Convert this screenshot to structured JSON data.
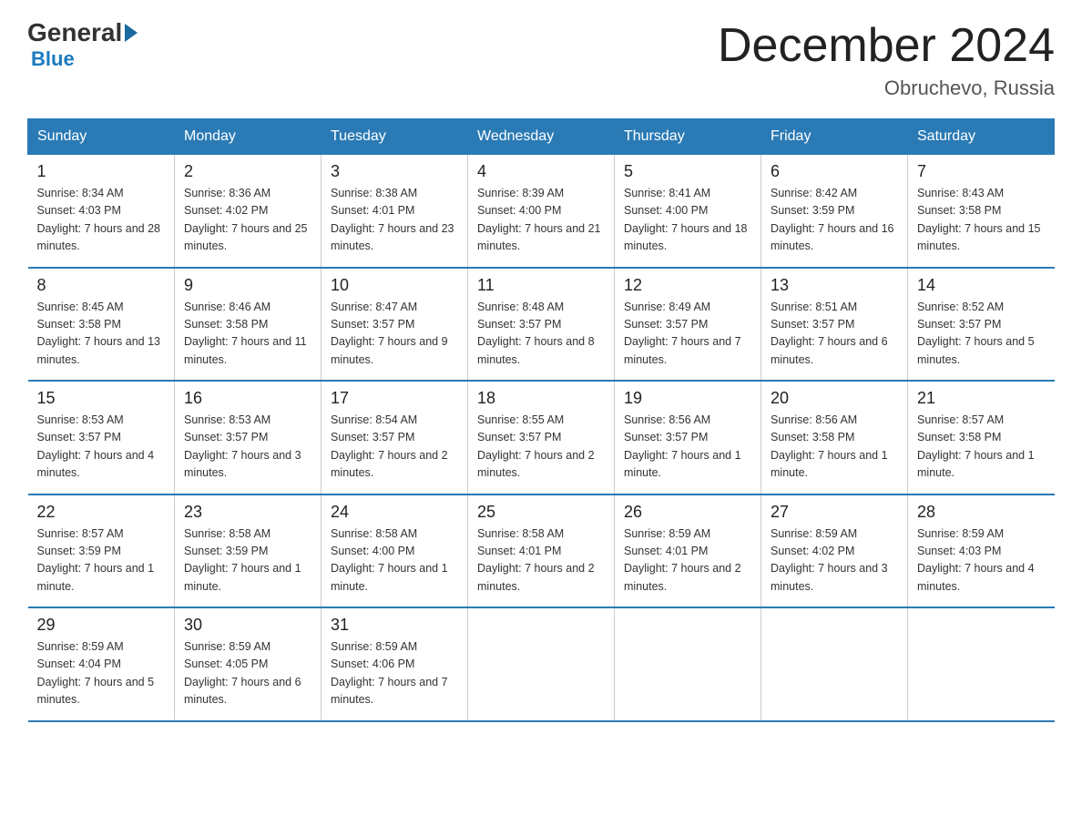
{
  "header": {
    "title": "December 2024",
    "location": "Obruchevo, Russia",
    "logo_general": "General",
    "logo_blue": "Blue"
  },
  "days_of_week": [
    "Sunday",
    "Monday",
    "Tuesday",
    "Wednesday",
    "Thursday",
    "Friday",
    "Saturday"
  ],
  "weeks": [
    [
      {
        "day": "1",
        "sunrise": "8:34 AM",
        "sunset": "4:03 PM",
        "daylight": "7 hours and 28 minutes."
      },
      {
        "day": "2",
        "sunrise": "8:36 AM",
        "sunset": "4:02 PM",
        "daylight": "7 hours and 25 minutes."
      },
      {
        "day": "3",
        "sunrise": "8:38 AM",
        "sunset": "4:01 PM",
        "daylight": "7 hours and 23 minutes."
      },
      {
        "day": "4",
        "sunrise": "8:39 AM",
        "sunset": "4:00 PM",
        "daylight": "7 hours and 21 minutes."
      },
      {
        "day": "5",
        "sunrise": "8:41 AM",
        "sunset": "4:00 PM",
        "daylight": "7 hours and 18 minutes."
      },
      {
        "day": "6",
        "sunrise": "8:42 AM",
        "sunset": "3:59 PM",
        "daylight": "7 hours and 16 minutes."
      },
      {
        "day": "7",
        "sunrise": "8:43 AM",
        "sunset": "3:58 PM",
        "daylight": "7 hours and 15 minutes."
      }
    ],
    [
      {
        "day": "8",
        "sunrise": "8:45 AM",
        "sunset": "3:58 PM",
        "daylight": "7 hours and 13 minutes."
      },
      {
        "day": "9",
        "sunrise": "8:46 AM",
        "sunset": "3:58 PM",
        "daylight": "7 hours and 11 minutes."
      },
      {
        "day": "10",
        "sunrise": "8:47 AM",
        "sunset": "3:57 PM",
        "daylight": "7 hours and 9 minutes."
      },
      {
        "day": "11",
        "sunrise": "8:48 AM",
        "sunset": "3:57 PM",
        "daylight": "7 hours and 8 minutes."
      },
      {
        "day": "12",
        "sunrise": "8:49 AM",
        "sunset": "3:57 PM",
        "daylight": "7 hours and 7 minutes."
      },
      {
        "day": "13",
        "sunrise": "8:51 AM",
        "sunset": "3:57 PM",
        "daylight": "7 hours and 6 minutes."
      },
      {
        "day": "14",
        "sunrise": "8:52 AM",
        "sunset": "3:57 PM",
        "daylight": "7 hours and 5 minutes."
      }
    ],
    [
      {
        "day": "15",
        "sunrise": "8:53 AM",
        "sunset": "3:57 PM",
        "daylight": "7 hours and 4 minutes."
      },
      {
        "day": "16",
        "sunrise": "8:53 AM",
        "sunset": "3:57 PM",
        "daylight": "7 hours and 3 minutes."
      },
      {
        "day": "17",
        "sunrise": "8:54 AM",
        "sunset": "3:57 PM",
        "daylight": "7 hours and 2 minutes."
      },
      {
        "day": "18",
        "sunrise": "8:55 AM",
        "sunset": "3:57 PM",
        "daylight": "7 hours and 2 minutes."
      },
      {
        "day": "19",
        "sunrise": "8:56 AM",
        "sunset": "3:57 PM",
        "daylight": "7 hours and 1 minute."
      },
      {
        "day": "20",
        "sunrise": "8:56 AM",
        "sunset": "3:58 PM",
        "daylight": "7 hours and 1 minute."
      },
      {
        "day": "21",
        "sunrise": "8:57 AM",
        "sunset": "3:58 PM",
        "daylight": "7 hours and 1 minute."
      }
    ],
    [
      {
        "day": "22",
        "sunrise": "8:57 AM",
        "sunset": "3:59 PM",
        "daylight": "7 hours and 1 minute."
      },
      {
        "day": "23",
        "sunrise": "8:58 AM",
        "sunset": "3:59 PM",
        "daylight": "7 hours and 1 minute."
      },
      {
        "day": "24",
        "sunrise": "8:58 AM",
        "sunset": "4:00 PM",
        "daylight": "7 hours and 1 minute."
      },
      {
        "day": "25",
        "sunrise": "8:58 AM",
        "sunset": "4:01 PM",
        "daylight": "7 hours and 2 minutes."
      },
      {
        "day": "26",
        "sunrise": "8:59 AM",
        "sunset": "4:01 PM",
        "daylight": "7 hours and 2 minutes."
      },
      {
        "day": "27",
        "sunrise": "8:59 AM",
        "sunset": "4:02 PM",
        "daylight": "7 hours and 3 minutes."
      },
      {
        "day": "28",
        "sunrise": "8:59 AM",
        "sunset": "4:03 PM",
        "daylight": "7 hours and 4 minutes."
      }
    ],
    [
      {
        "day": "29",
        "sunrise": "8:59 AM",
        "sunset": "4:04 PM",
        "daylight": "7 hours and 5 minutes."
      },
      {
        "day": "30",
        "sunrise": "8:59 AM",
        "sunset": "4:05 PM",
        "daylight": "7 hours and 6 minutes."
      },
      {
        "day": "31",
        "sunrise": "8:59 AM",
        "sunset": "4:06 PM",
        "daylight": "7 hours and 7 minutes."
      },
      null,
      null,
      null,
      null
    ]
  ]
}
